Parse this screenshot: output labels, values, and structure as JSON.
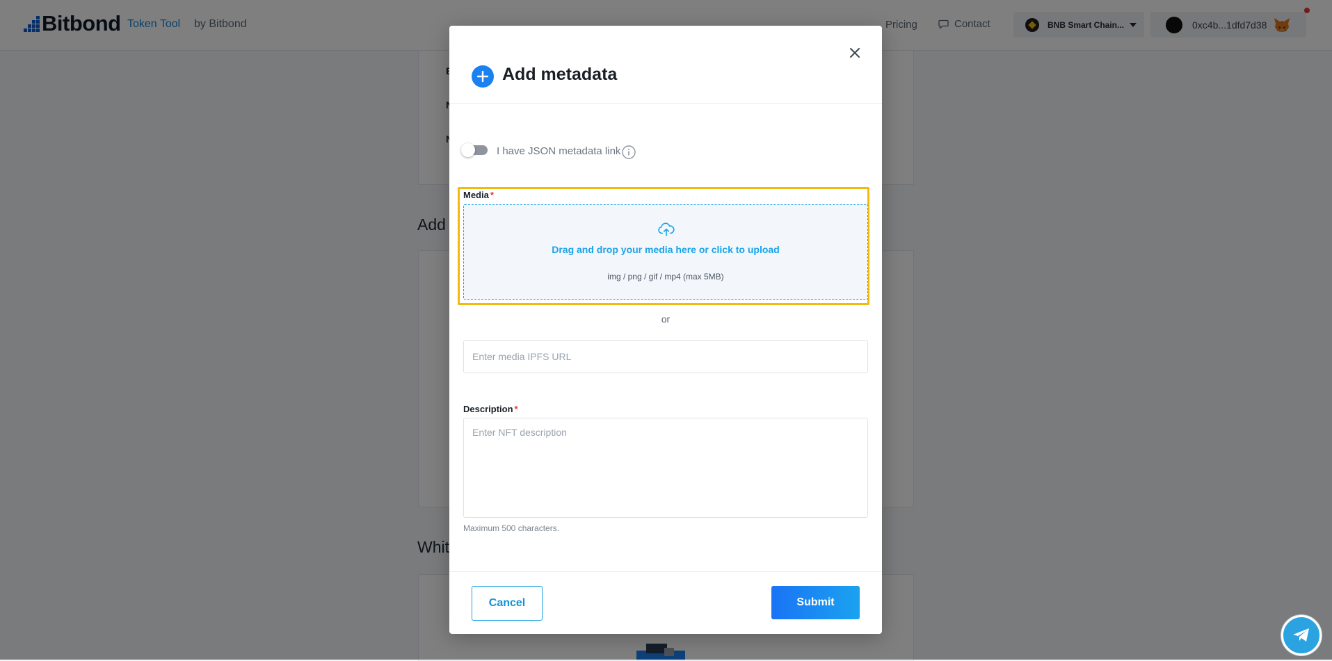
{
  "header": {
    "brand": "Bitbond",
    "token_tool_link": "Token Tool",
    "token_tool_suffix": "by Bitbond",
    "nav_pricing": "Pricing",
    "nav_contact": "Contact",
    "network_label": "BNB Smart Chain...",
    "wallet_address": "0xc4b...1dfd7d38"
  },
  "background": {
    "section_heading_partial_1": "Add",
    "section_heading_partial_2": "Whit"
  },
  "modal": {
    "title": "Add metadata",
    "json_toggle_label": "I have JSON metadata link",
    "json_toggle_on": false,
    "media": {
      "label": "Media",
      "required_mark": "*",
      "dropzone_text": "Drag and drop your media here or click to upload",
      "dropzone_hint": "img / png / gif / mp4 (max 5MB)",
      "highlight_color": "#f2b90f"
    },
    "or_text": "or",
    "ipfs_url": {
      "value": "",
      "placeholder": "Enter media IPFS URL"
    },
    "description": {
      "label": "Description",
      "required_mark": "*",
      "value": "",
      "placeholder": "Enter NFT description",
      "helper": "Maximum 500 characters."
    },
    "cancel_label": "Cancel",
    "submit_label": "Submit"
  },
  "colors": {
    "accent": "#1aa3e8",
    "primary_button": "#1a82f0",
    "required": "#e53935",
    "telegram": "#2aa3e0"
  },
  "icons": [
    "close-icon",
    "plus-icon",
    "info-icon",
    "cloud-upload-icon",
    "chat-icon",
    "bnb-icon",
    "metamask-fox-icon",
    "telegram-icon"
  ]
}
